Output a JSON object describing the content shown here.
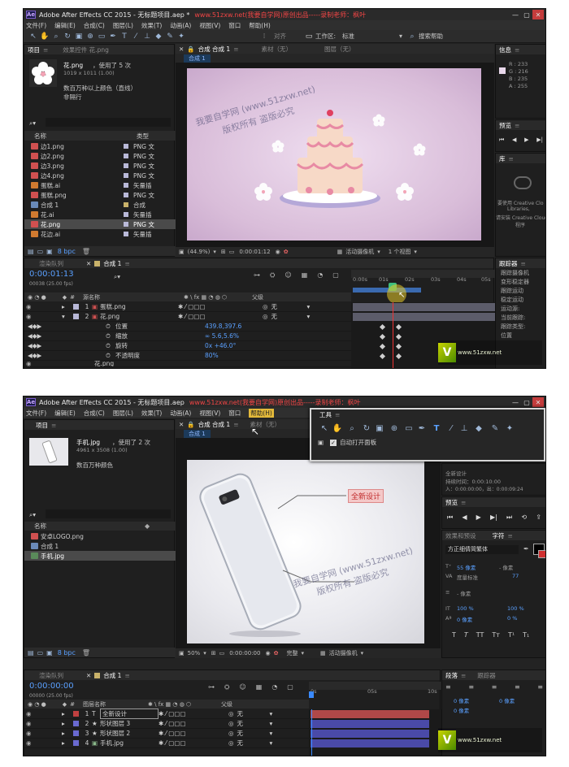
{
  "screens": [
    {
      "window_title": "Adobe After Effects CC 2015 - 无标题项目.aep *",
      "watermark_title": "www.51zxw.net(我要自学网)原创出品-----录制老师：枫叶",
      "menu": [
        "文件(F)",
        "编辑(E)",
        "合成(C)",
        "图层(L)",
        "效果(T)",
        "动画(A)",
        "视图(V)",
        "窗口",
        "帮助(H)"
      ],
      "toolbar": {
        "align": "对齐",
        "workspace_label": "工作区:",
        "workspace_value": "标准",
        "search": "搜索帮助"
      },
      "project": {
        "tab": "项目",
        "effects_tab": "效果控件 花.png",
        "item_name": "花.png",
        "used": "，使用了 5 次",
        "dims": "1019 x 1011 (1.00)",
        "desc1": "数百万种以上颜色（直线）",
        "desc2": "非隔行",
        "col_name": "名称",
        "col_type": "类型",
        "bpc": "8 bpc",
        "files": [
          {
            "name": "边1.png",
            "type": "PNG 文"
          },
          {
            "name": "边2.png",
            "type": "PNG 文"
          },
          {
            "name": "边3.png",
            "type": "PNG 文"
          },
          {
            "name": "边4.png",
            "type": "PNG 文"
          },
          {
            "name": "蛋糕.ai",
            "type": "矢量插"
          },
          {
            "name": "蛋糕.png",
            "type": "PNG 文"
          },
          {
            "name": "合成 1",
            "type": "合成"
          },
          {
            "name": "花.ai",
            "type": "矢量插"
          },
          {
            "name": "花.png",
            "type": "PNG 文"
          },
          {
            "name": "花边.ai",
            "type": "矢量插"
          }
        ]
      },
      "viewer": {
        "tab_comp": "合成 合成 1",
        "tab_footage": "素材（无）",
        "tab_layer": "图层（无）",
        "breadcrumb": "合成 1",
        "zoom": "(44.9%)",
        "timecode": "0:00:01:12",
        "camera": "活动摄像机",
        "views": "1 个视图"
      },
      "watermark": {
        "line1": "我要自学网 (www.51zxw.net)",
        "line2": "版权所有  盗版必究"
      },
      "info": {
        "tab": "信息",
        "r": "R : 233",
        "g": "G : 216",
        "b": "B : 235",
        "a": "A : 255"
      },
      "preview": {
        "tab": "预览"
      },
      "library": {
        "tab": "库",
        "msg1": "要使用 Creative Clo",
        "msg2": "Libraries,",
        "msg3": "请安装 Creative Cloud",
        "msg4": "程序"
      },
      "tracker": {
        "tab": "跟踪器",
        "items": [
          "跟踪摄像机",
          "变形稳定器",
          "跟踪运动",
          "稳定运动",
          "运动源:",
          "当前跟踪:",
          "跟踪类型:",
          "位置"
        ]
      },
      "timeline": {
        "render_tab": "渲染队列",
        "comp_tab": "合成 1",
        "timecode": "0:00:01:13",
        "fps": "00038 (25.00 fps)",
        "col_src": "源名称",
        "col_parent": "父级",
        "ticks": [
          "0:00s",
          "01s",
          "02s",
          "03s",
          "04s",
          "05s"
        ],
        "layers": [
          {
            "num": "1",
            "name": "蛋糕.png",
            "parent": "无",
            "color": "#b7b7d6"
          },
          {
            "num": "2",
            "name": "花.png",
            "parent": "无",
            "color": "#b7b7d6"
          }
        ],
        "props": [
          {
            "name": "位置",
            "value": "439.8,397.6"
          },
          {
            "name": "缩放",
            "value": "∞ 5.6,5.6%"
          },
          {
            "name": "旋转",
            "value": "0x +46.0°"
          },
          {
            "name": "不透明度",
            "value": "80%"
          }
        ],
        "next_layer": "花.png"
      },
      "logo": "www.51zxw.net"
    },
    {
      "window_title": "Adobe After Effects CC 2015 - 无标题项目.aep",
      "watermark_title": "www.51zxw.net(我要自学网)原创出品-----录制老师：枫叶",
      "menu": [
        "文件(F)",
        "编辑(E)",
        "合成(C)",
        "图层(L)",
        "效果(T)",
        "动画(A)",
        "视图(V)",
        "窗口",
        "帮助(H)"
      ],
      "project": {
        "tab": "项目",
        "item_name": "手机.jpg",
        "used": "，使用了 2 次",
        "dims": "4961 x 3508 (1.00)",
        "desc1": "数百万种颜色",
        "col_name": "名称",
        "bpc": "8 bpc",
        "files": [
          {
            "name": "安卓LOGO.png"
          },
          {
            "name": "合成 1"
          },
          {
            "name": "手机.jpg"
          }
        ]
      },
      "viewer": {
        "tab_comp": "合成 合成 1",
        "tab_footage": "素材（无）",
        "breadcrumb": "合成 1",
        "zoom": "50%",
        "timecode": "0:00:00:00",
        "quality": "完整",
        "camera": "活动摄像机",
        "callout": "全新设计"
      },
      "watermark": {
        "line1": "我要自学网 (www.51zxw.net)",
        "line2": "版权所有  盗版必究"
      },
      "tools": {
        "title": "工具",
        "auto_open": "自动打开面板"
      },
      "info": {
        "name": "全新设计",
        "duration": "持续时间：0:00:10:00",
        "range": "入：0:00:00:00，出：0:00:09:24"
      },
      "preview": {
        "tab": "预览"
      },
      "effects_tab": "效果和预设",
      "char_tab": "字符",
      "character": {
        "font": "方正细倩简繁体",
        "size": "55 像素",
        "tracking": "度量标准",
        "kerning": "77",
        "leading": "- 像素",
        "vscale": "100 %",
        "hscale": "100 %",
        "baseline": "0 像素",
        "tsume": "0 %"
      },
      "para_tab": "段落",
      "tracker_tab": "跟踪器",
      "paragraph": {
        "indent": "0 像素",
        "space": "0 像素"
      },
      "timeline": {
        "render_tab": "渲染队列",
        "comp_tab": "合成 1",
        "timecode": "0:00:00:00",
        "fps": "00000 (25.00 fps)",
        "col_src": "图层名称",
        "col_parent": "父级",
        "ticks": [
          "0s",
          "05s",
          "10s"
        ],
        "layers": [
          {
            "num": "1",
            "name": "全新设计",
            "parent": "无",
            "color": "#c04040",
            "bar": "#c04040"
          },
          {
            "num": "2",
            "name": "形状图层 3",
            "parent": "无",
            "color": "#6a6ad0",
            "bar": "#4a4aa8"
          },
          {
            "num": "3",
            "name": "形状图层 2",
            "parent": "无",
            "color": "#6a6ad0",
            "bar": "#4a4aa8"
          },
          {
            "num": "4",
            "name": "手机.jpg",
            "parent": "无",
            "color": "#6a6ad0",
            "bar": "#4a4aa8"
          }
        ]
      },
      "logo": "www.51zxw.net"
    }
  ]
}
